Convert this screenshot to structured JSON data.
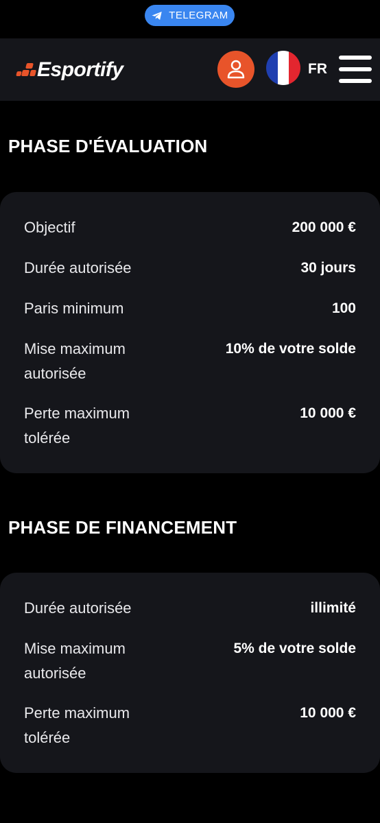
{
  "telegram": {
    "label": "TELEGRAM",
    "icon": "telegram-icon"
  },
  "header": {
    "logo_text": "Esportify",
    "user_icon": "user-icon",
    "language": "FR",
    "flag_icon": "france-flag-icon",
    "menu_icon": "hamburger-menu-icon"
  },
  "colors": {
    "accent": "#e8542a",
    "telegram_blue": "#3a86f0",
    "card_bg": "#15161b",
    "page_bg": "#000000"
  },
  "evaluation": {
    "title": "PHASE D'ÉVALUATION",
    "rows": [
      {
        "label": "Objectif",
        "value": "200 000 €"
      },
      {
        "label": "Durée autorisée",
        "value": "30 jours"
      },
      {
        "label": "Paris minimum",
        "value": "100"
      },
      {
        "label": "Mise maximum autorisée",
        "value": "10% de votre solde"
      },
      {
        "label": "Perte maximum tolérée",
        "value": "10 000 €"
      }
    ]
  },
  "funding": {
    "title": "PHASE DE FINANCEMENT",
    "rows": [
      {
        "label": "Durée autorisée",
        "value": "illimité"
      },
      {
        "label": "Mise maximum autorisée",
        "value": "5% de votre solde"
      },
      {
        "label": "Perte maximum tolérée",
        "value": "10 000 €"
      }
    ]
  }
}
